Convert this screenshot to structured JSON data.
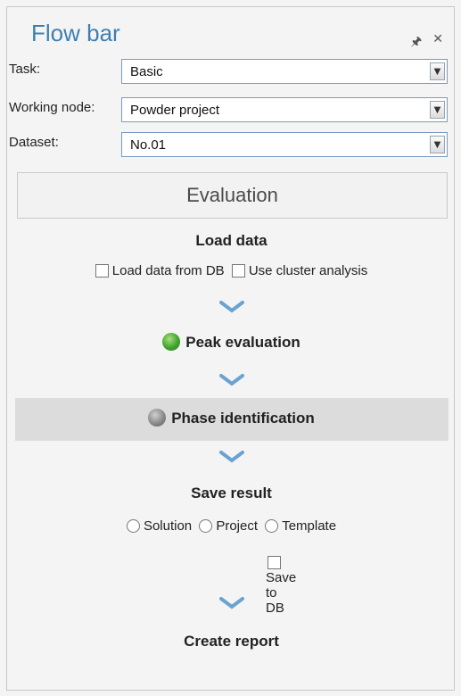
{
  "panel": {
    "title": "Flow bar",
    "pin_icon": "pin-icon",
    "close_icon": "close-icon"
  },
  "fields": [
    {
      "label": "Task:",
      "value": "Basic"
    },
    {
      "label": "Working node:",
      "value": "Powder project"
    },
    {
      "label": "Dataset:",
      "value": "No.01"
    }
  ],
  "evaluation_button": "Evaluation",
  "steps": {
    "load_data": {
      "title": "Load data",
      "options": [
        "Load data from DB",
        "Use cluster analysis"
      ]
    },
    "peak_evaluation": {
      "title": "Peak evaluation",
      "status_color": "#3fa332"
    },
    "phase_identification": {
      "title": "Phase identification",
      "status_color": "#8a8a8a"
    },
    "save_result": {
      "title": "Save result",
      "radio_options": [
        "Solution",
        "Project",
        "Template"
      ],
      "save_to_db": "Save to DB"
    },
    "create_report": {
      "title": "Create report"
    }
  },
  "colors": {
    "title": "#3e7fb3",
    "chevron": "#6aa3d1",
    "highlight": "#dcdcdc"
  }
}
